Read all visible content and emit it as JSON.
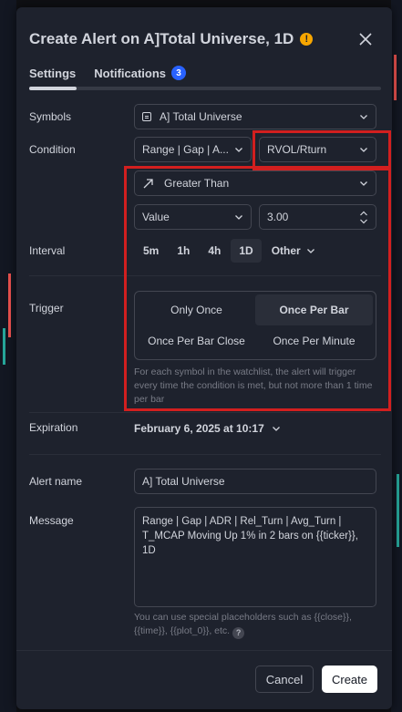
{
  "dialog": {
    "title": "Create Alert on A]Total Universe, 1D",
    "warn_icon": "!",
    "close_icon": "close-icon"
  },
  "tabs": [
    {
      "label": "Settings",
      "active": true
    },
    {
      "label": "Notifications",
      "badge": "3",
      "active": false
    }
  ],
  "symbols": {
    "label": "Symbols",
    "value": "A] Total Universe",
    "icon": "list-icon"
  },
  "condition": {
    "label": "Condition",
    "indicator": "Range | Gap | A...",
    "plot": "RVOL/Rturn",
    "operator": "Greater Than",
    "operator_icon": "trend-arrow-icon",
    "value_type": "Value",
    "value": "3.00"
  },
  "interval": {
    "label": "Interval",
    "options": [
      "5m",
      "1h",
      "4h",
      "1D"
    ],
    "active": "1D",
    "other_label": "Other"
  },
  "trigger": {
    "label": "Trigger",
    "options": [
      "Only Once",
      "Once Per Bar",
      "Once Per Bar Close",
      "Once Per Minute"
    ],
    "active": "Once Per Bar",
    "hint": "For each symbol in the watchlist, the alert will trigger every time the condition is met, but not more than 1 time per bar"
  },
  "expiration": {
    "label": "Expiration",
    "value": "February 6, 2025 at 10:17"
  },
  "alert_name": {
    "label": "Alert name",
    "value": "A] Total Universe"
  },
  "message": {
    "label": "Message",
    "value": "Range | Gap | ADR | Rel_Turn | Avg_Turn | T_MCAP Moving Up 1% in 2 bars on {{ticker}}, 1D",
    "footnote": "You can use special placeholders such as {{close}}, {{time}}, {{plot_0}}, etc.",
    "help_icon": "?"
  },
  "footer": {
    "cancel_label": "Cancel",
    "create_label": "Create"
  },
  "colors": {
    "accent": "#2962ff",
    "warning": "#f7a600",
    "highlight": "#d21f1f",
    "dialog_bg": "#1e222d"
  }
}
